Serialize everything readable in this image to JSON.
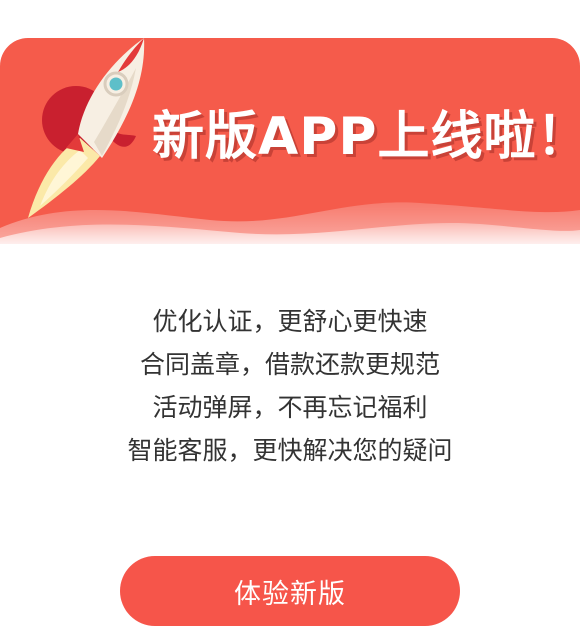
{
  "banner": {
    "headline": "新版APP上线啦！",
    "background_color": "#f55b4b",
    "accent_color": "#c9202f",
    "rocket_icon": "rocket-icon"
  },
  "features": [
    "优化认证，更舒心更快速",
    "合同盖章，借款还款更规范",
    "活动弹屏，不再忘记福利",
    "智能客服，更快解决您的疑问"
  ],
  "cta": {
    "label": "体验新版",
    "color": "#f6554a"
  }
}
